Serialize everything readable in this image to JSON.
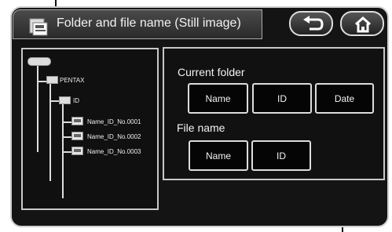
{
  "header": {
    "title": "Folder and file name (Still image)",
    "icon": "folder-file-icon"
  },
  "nav": {
    "back_icon": "back-arrow-icon",
    "home_icon": "home-icon"
  },
  "tree": {
    "root": "PENTAX",
    "folder": "ID",
    "files": [
      "Name_ID_No.0001",
      "Name_ID_No.0002",
      "Name_ID_No.0003"
    ]
  },
  "current_folder": {
    "label": "Current folder",
    "buttons": [
      "Name",
      "ID",
      "Date"
    ]
  },
  "file_name": {
    "label": "File name",
    "buttons": [
      "Name",
      "ID"
    ]
  },
  "colors": {
    "panel_border": "#cfcfcf",
    "background": "#141414",
    "text": "#f2f2f2"
  }
}
